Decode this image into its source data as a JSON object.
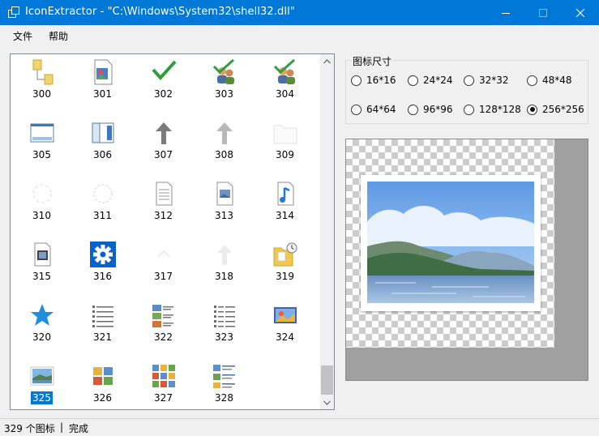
{
  "window": {
    "title": "IconExtractor - \"C:\\Windows\\System32\\shell32.dll\"",
    "accent": "#0078d7"
  },
  "menu": {
    "file": "文件",
    "help": "帮助"
  },
  "icons": [
    {
      "label": "300",
      "icon": "shortcut-overlay-icon"
    },
    {
      "label": "301",
      "icon": "picture-document-icon"
    },
    {
      "label": "302",
      "icon": "green-checkmark-icon"
    },
    {
      "label": "303",
      "icon": "users-check-icon"
    },
    {
      "label": "304",
      "icon": "users-check-icon"
    },
    {
      "label": "305",
      "icon": "window-frame-icon"
    },
    {
      "label": "306",
      "icon": "window-columns-icon"
    },
    {
      "label": "307",
      "icon": "arrow-up-icon"
    },
    {
      "label": "308",
      "icon": "arrow-up-light-icon"
    },
    {
      "label": "309",
      "icon": "blank-folder-icon"
    },
    {
      "label": "310",
      "icon": "faint-ring-icon"
    },
    {
      "label": "311",
      "icon": "faint-ring-icon"
    },
    {
      "label": "312",
      "icon": "text-document-icon"
    },
    {
      "label": "313",
      "icon": "image-document-icon"
    },
    {
      "label": "314",
      "icon": "music-document-icon"
    },
    {
      "label": "315",
      "icon": "video-document-icon"
    },
    {
      "label": "316",
      "icon": "gear-icon"
    },
    {
      "label": "317",
      "icon": "faint-chevron-icon"
    },
    {
      "label": "318",
      "icon": "faint-arrow-up-icon"
    },
    {
      "label": "319",
      "icon": "folder-clock-icon"
    },
    {
      "label": "320",
      "icon": "blue-star-icon"
    },
    {
      "label": "321",
      "icon": "details-list-icon"
    },
    {
      "label": "322",
      "icon": "tiles-list-icon"
    },
    {
      "label": "323",
      "icon": "details-list-icon"
    },
    {
      "label": "324",
      "icon": "photo-frame-icon"
    },
    {
      "label": "325",
      "icon": "landscape-icon",
      "selected": true
    },
    {
      "label": "326",
      "icon": "thumbnail-grid-icon"
    },
    {
      "label": "327",
      "icon": "thumbnail-grid-large-icon"
    },
    {
      "label": "328",
      "icon": "content-list-icon"
    }
  ],
  "size_group": {
    "legend": "图标尺寸",
    "options": [
      "16*16",
      "24*24",
      "32*32",
      "48*48",
      "64*64",
      "96*96",
      "128*128",
      "256*256"
    ],
    "selected": "256*256"
  },
  "status": {
    "count": "329 个图标",
    "separator": "|",
    "state": "完成"
  }
}
